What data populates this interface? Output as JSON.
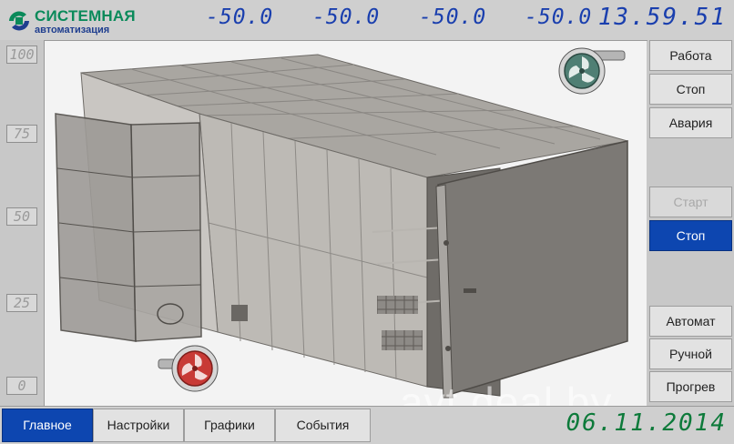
{
  "header": {
    "logo_line1": "СИСТЕМНАЯ",
    "logo_line2": "автоматизация",
    "temperatures": [
      "-50.0",
      "-50.0",
      "-50.0",
      "-50.0"
    ],
    "clock": "13.59.51"
  },
  "scale": {
    "ticks": [
      "100",
      "75",
      "50",
      "25",
      "0"
    ]
  },
  "right_panel": {
    "work": "Работа",
    "stop": "Стоп",
    "alarm": "Авария",
    "start": "Старт",
    "stop2": "Стоп",
    "auto": "Автомат",
    "manual": "Ручной",
    "preheat": "Прогрев"
  },
  "tabs": [
    "Главное",
    "Настройки",
    "Графики",
    "События"
  ],
  "footer": {
    "date": "06.11.2014"
  },
  "watermark": "avt.deal.by",
  "colors": {
    "accent": "#0d46b0",
    "digits_blue": "#1a3fae",
    "digits_green": "#0d7a3a",
    "fan_top": "#4f7f74",
    "fan_bottom": "#c83a36"
  },
  "icons": {
    "top_fan": "fan-running-icon",
    "bottom_fan": "fan-stopped-icon"
  }
}
